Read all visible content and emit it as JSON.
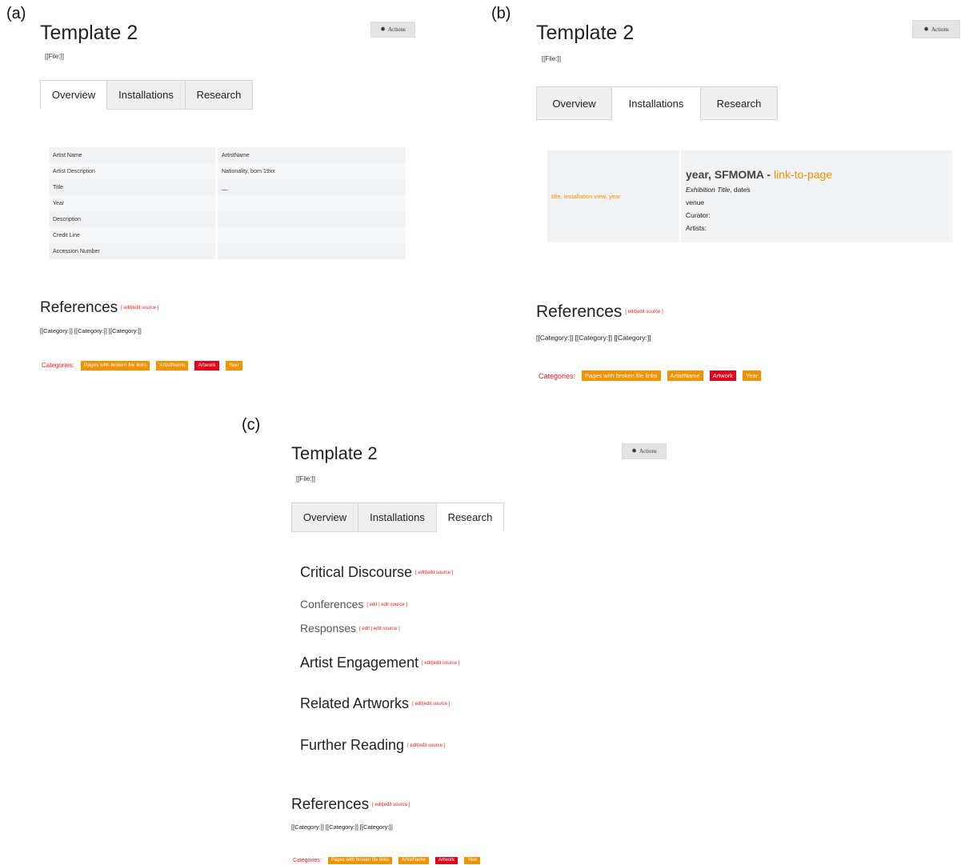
{
  "panels": {
    "a": {
      "label": "(a)",
      "title": "Template 2",
      "file_ref": "[[File:]]",
      "actions_label": "Actions",
      "tabs": [
        "Overview",
        "Installations",
        "Research"
      ],
      "active_tab": "Overview",
      "properties": [
        {
          "key": "Artist Name",
          "value": "ArtistName"
        },
        {
          "key": "Artist Description",
          "value": "Nationality, born 19xx"
        },
        {
          "key": "Title",
          "value": "__"
        },
        {
          "key": "Year",
          "value": ""
        },
        {
          "key": "Description",
          "value": ""
        },
        {
          "key": "Credit Line",
          "value": ""
        },
        {
          "key": "Accession Number",
          "value": ""
        }
      ],
      "references_title": "References",
      "references_edit": "[ edit|edit source ]",
      "category_refs": "[[Category:]] [[Category:]] [[Category:]]",
      "categories_label": "Categories:",
      "categories": [
        "Pages with broken file links",
        "ArtistName",
        "Artwork",
        "Year"
      ]
    },
    "b": {
      "label": "(b)",
      "title": "Template 2",
      "file_ref": "[[File:]]",
      "actions_label": "Actions",
      "tabs": [
        "Overview",
        "Installations",
        "Research"
      ],
      "active_tab": "Installations",
      "installation": {
        "image_caption": "title, installation view, year",
        "heading_main": "year, SFMOMA",
        "heading_sep": " - ",
        "heading_link": "link-to-page",
        "exhibition_title": "Exhibition Title",
        "exhibition_rest": ", dates",
        "venue": "venue",
        "curator": "Curator:",
        "artists": "Artists:"
      },
      "references_title": "References",
      "references_edit": "[ edit|edit source ]",
      "category_refs": "[[Category:]] [[Category:]] [[Category:]]",
      "categories_label": "Categories:",
      "categories": [
        "Pages with broken file links",
        "ArtistName",
        "Artwork",
        "Year"
      ]
    },
    "c": {
      "label": "(c)",
      "title": "Template 2",
      "file_ref": "[[File:]]",
      "actions_label": "Actions",
      "tabs": [
        "Overview",
        "Installations",
        "Research"
      ],
      "active_tab": "Research",
      "sections": [
        {
          "title": "Critical Discourse",
          "edit": "[ edit|edit source ]"
        },
        {
          "title": "Conferences",
          "edit": "[ edit | edit source ]"
        },
        {
          "title": "Responses",
          "edit": "[ edit | edit source ]"
        },
        {
          "title": "Artist Engagement",
          "edit": "[ edit|edit source ]"
        },
        {
          "title": "Related Artworks",
          "edit": "[ edit|edit source ]"
        },
        {
          "title": "Further Reading",
          "edit": "[ edit|edit source ]"
        }
      ],
      "references_title": "References",
      "references_edit": "[ edit|edit source ]",
      "category_refs": "[[Category:]] [[Category:]] [[Category:]]",
      "categories_label": "Categories:",
      "categories": [
        "Pages with broken file links",
        "ArtistName",
        "Artwork",
        "Year"
      ]
    }
  },
  "colors": {
    "accent_orange": "#f39200",
    "accent_red": "#e2001a",
    "edit_link_red": "#e02020"
  },
  "icons": {
    "actions": "gear-icon"
  }
}
